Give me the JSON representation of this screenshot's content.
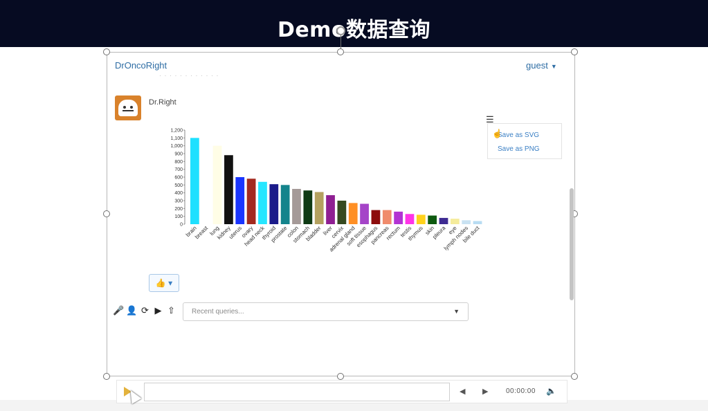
{
  "banner": {
    "title": "Demo数据查询"
  },
  "app": {
    "name": "DrOncoRight",
    "user": "guest"
  },
  "chat": {
    "bot_name": "Dr.Right"
  },
  "export_menu": {
    "svg": "Save as SVG",
    "png": "Save as PNG"
  },
  "query": {
    "placeholder": "Recent queries..."
  },
  "player": {
    "time": "00:00:00"
  },
  "chart_data": {
    "type": "bar",
    "title": "",
    "xlabel": "",
    "ylabel": "",
    "ylim": [
      0,
      1200
    ],
    "yticks": [
      "0",
      "100",
      "200",
      "300",
      "400",
      "500",
      "600",
      "700",
      "800",
      "900",
      "1,000",
      "1,100",
      "1,200"
    ],
    "grid": false,
    "categories": [
      "brain",
      "breast",
      "lung",
      "kidney",
      "uterus",
      "ovary",
      "head neck",
      "thyroid",
      "prostate",
      "colon",
      "stomach",
      "bladder",
      "liver",
      "cervix",
      "adrenal gland",
      "soft tissue",
      "esophagus",
      "pancreas",
      "rectum",
      "testis",
      "thymus",
      "skin",
      "pleura",
      "eye",
      "lymph nodes",
      "bile duct"
    ],
    "values": [
      1100,
      10,
      1000,
      880,
      600,
      580,
      540,
      510,
      500,
      450,
      430,
      410,
      370,
      300,
      270,
      260,
      180,
      180,
      160,
      130,
      120,
      110,
      80,
      70,
      50,
      40
    ],
    "colors": [
      "#1ee0ff",
      "#ffffff",
      "#fffde6",
      "#111111",
      "#1a35ff",
      "#a32a1f",
      "#26e6ff",
      "#1b1b8a",
      "#14848c",
      "#a59a98",
      "#0f3a14",
      "#b4a160",
      "#8f1f92",
      "#364a20",
      "#ff8f24",
      "#a544c8",
      "#8d0c0c",
      "#f08b6c",
      "#b233d3",
      "#ff34e8",
      "#ffd21c",
      "#0e5a10",
      "#3e2b92",
      "#f5ec9c",
      "#c9e2f2",
      "#b8dcf2"
    ]
  }
}
